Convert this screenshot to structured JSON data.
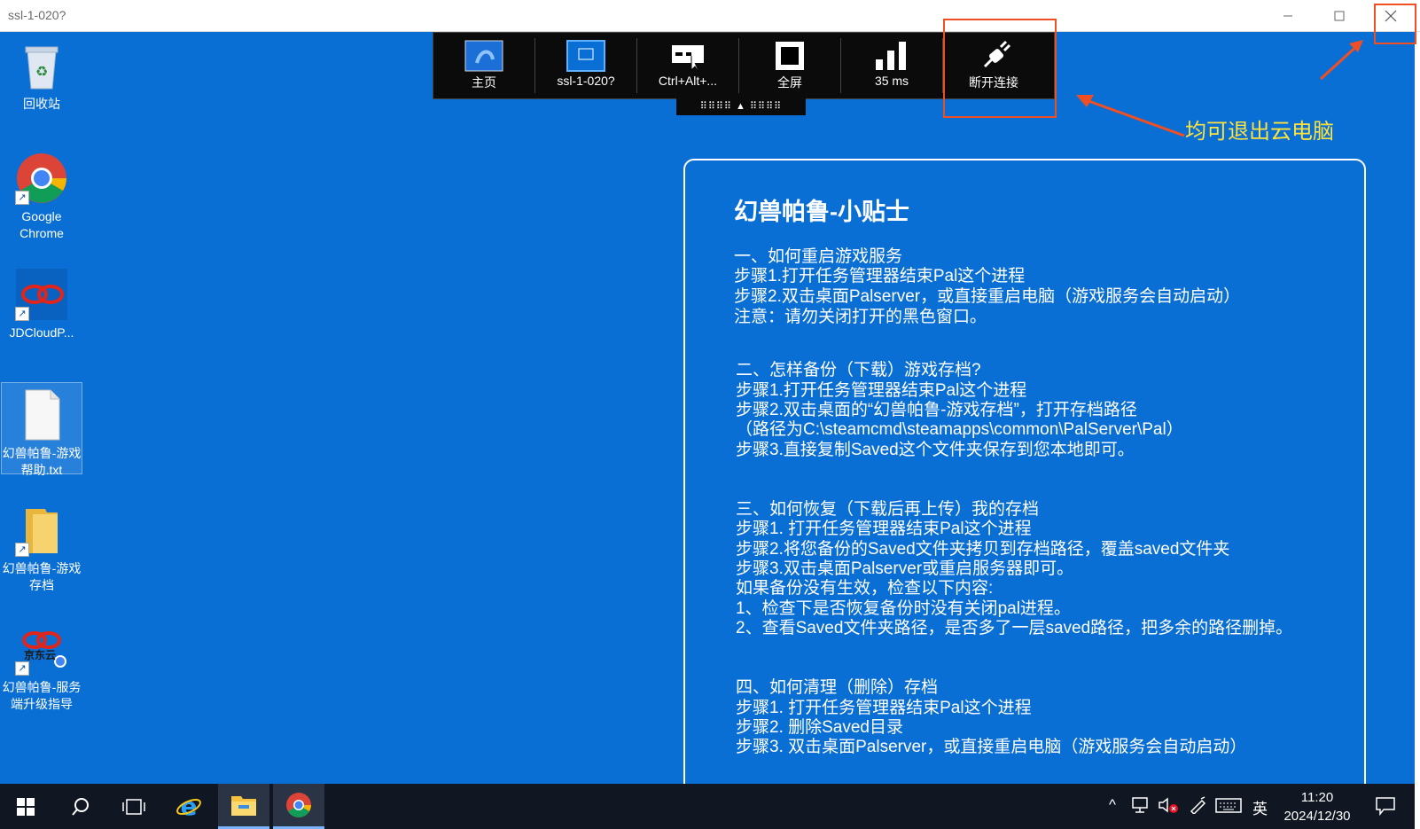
{
  "window": {
    "title": "ssl-1-020?",
    "min_icon": "minimize-icon",
    "max_icon": "maximize-icon",
    "close_icon": "close-icon"
  },
  "desktop_icons": [
    {
      "label": "回收站",
      "icon": "recycle-bin-icon"
    },
    {
      "label": "Google Chrome",
      "icon": "chrome-icon"
    },
    {
      "label": "JDCloudP...",
      "icon": "jdcloud-icon"
    },
    {
      "label": "幻兽帕鲁-游戏帮助.txt",
      "icon": "text-file-icon"
    },
    {
      "label": "幻兽帕鲁-游戏存档",
      "icon": "folder-icon"
    },
    {
      "label": "幻兽帕鲁-服务端升级指导",
      "icon": "jdcloud-shortcut-icon",
      "logo_text": "京东云"
    }
  ],
  "toolbar": {
    "items": [
      {
        "label": "主页",
        "icon": "home-icon"
      },
      {
        "label": "ssl-1-020?",
        "icon": "remote-desktop-icon"
      },
      {
        "label": "Ctrl+Alt+...",
        "icon": "keyboard-shortcut-icon"
      },
      {
        "label": "全屏",
        "icon": "fullscreen-icon"
      },
      {
        "label": "35 ms",
        "icon": "signal-icon"
      },
      {
        "label": "断开连接",
        "icon": "disconnect-icon"
      }
    ],
    "handle": "⠿⠿⠿⠿ ▲ ⠿⠿⠿⠿"
  },
  "annotation": "均可退出云电脑",
  "tips": {
    "title": "幻兽帕鲁-小贴士",
    "lines": [
      "一、如何重启游戏服务",
      " 步骤1.打开任务管理器结束Pal这个进程",
      " 步骤2.双击桌面Palserver，或直接重启电脑（游戏服务会自动启动）",
      " 注意：请勿关闭打开的黑色窗口。",
      "二、怎样备份（下载）游戏存档?",
      " 步骤1.打开任务管理器结束Pal这个进程",
      " 步骤2.双击桌面的“幻兽帕鲁-游戏存档”，打开存档路径",
      "（路径为C:\\steamcmd\\steamapps\\common\\PalServer\\Pal）",
      " 步骤3.直接复制Saved这个文件夹保存到您本地即可。",
      "三、如何恢复（下载后再上传）我的存档",
      " 步骤1. 打开任务管理器结束Pal这个进程",
      " 步骤2.将您备份的Saved文件夹拷贝到存档路径，覆盖saved文件夹",
      " 步骤3.双击桌面Palserver或重启服务器即可。",
      " 如果备份没有生效，检查以下内容:",
      " 1、检查下是否恢复备份时没有关闭pal进程。",
      " 2、查看Saved文件夹路径，是否多了一层saved路径，把多余的路径删掉。",
      "四、如何清理（删除）存档",
      " 步骤1.  打开任务管理器结束Pal这个进程",
      " 步骤2.  删除Saved目录",
      " 步骤3.  双击桌面Palserver，或直接重启电脑（游戏服务会自动启动）"
    ]
  },
  "taskbar": {
    "start_icon": "windows-start-icon",
    "search_icon": "search-icon",
    "taskview_icon": "task-view-icon",
    "apps": [
      "internet-explorer-icon",
      "file-explorer-icon",
      "chrome-icon"
    ],
    "tray": {
      "chevron": "^",
      "ime": "英",
      "time": "11:20",
      "date": "2024/12/30"
    }
  },
  "colors": {
    "desktop": "#0a6fd4",
    "highlight": "#f04e23",
    "annotation": "#ffe23b",
    "taskbar": "#101722"
  }
}
